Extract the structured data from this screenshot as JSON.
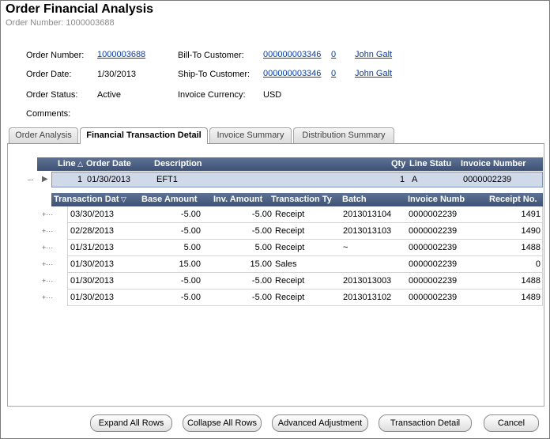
{
  "header": {
    "title": "Order Financial Analysis",
    "subtitle": "Order Number: 1000003688"
  },
  "summary": {
    "order_number_label": "Order Number:",
    "order_number": "1000003688",
    "order_date_label": "Order Date:",
    "order_date": "1/30/2013",
    "order_status_label": "Order Status:",
    "order_status": "Active",
    "comments_label": "Comments:",
    "bill_to_label": "Bill-To Customer:",
    "bill_to_id": "000000003346",
    "bill_to_zero": "0",
    "bill_to_name": "John Galt",
    "ship_to_label": "Ship-To Customer:",
    "ship_to_id": "000000003346",
    "ship_to_zero": "0",
    "ship_to_name": "John Galt",
    "currency_label": "Invoice Currency:",
    "currency": "USD"
  },
  "tabs": [
    {
      "label": "Order Analysis"
    },
    {
      "label": "Financial Transaction Detail"
    },
    {
      "label": "Invoice Summary"
    },
    {
      "label": "Distribution Summary"
    }
  ],
  "outer_grid": {
    "columns": [
      "Line",
      "Order Date",
      "Description",
      "Qty",
      "Line Statu",
      "Invoice Number"
    ],
    "row": {
      "line": "1",
      "order_date": "01/30/2013",
      "description": "EFT1",
      "qty": "1",
      "status": "A",
      "invoice": "0000002239"
    }
  },
  "inner_grid": {
    "columns": [
      "Transaction Dat",
      "Base Amount",
      "Inv. Amount",
      "Transaction Ty",
      "Batch",
      "Invoice Numb",
      "Receipt No."
    ],
    "rows": [
      {
        "date": "03/30/2013",
        "base": "-5.00",
        "inv": "-5.00",
        "type": "Receipt",
        "batch": "2013013104",
        "invoice": "0000002239",
        "receipt": "1491"
      },
      {
        "date": "02/28/2013",
        "base": "-5.00",
        "inv": "-5.00",
        "type": "Receipt",
        "batch": "2013013103",
        "invoice": "0000002239",
        "receipt": "1490"
      },
      {
        "date": "01/31/2013",
        "base": "5.00",
        "inv": "5.00",
        "type": "Receipt",
        "batch": "~",
        "invoice": "0000002239",
        "receipt": "1488"
      },
      {
        "date": "01/30/2013",
        "base": "15.00",
        "inv": "15.00",
        "type": "Sales",
        "batch": "",
        "invoice": "0000002239",
        "receipt": "0"
      },
      {
        "date": "01/30/2013",
        "base": "-5.00",
        "inv": "-5.00",
        "type": "Receipt",
        "batch": "2013013003",
        "invoice": "0000002239",
        "receipt": "1488"
      },
      {
        "date": "01/30/2013",
        "base": "-5.00",
        "inv": "-5.00",
        "type": "Receipt",
        "batch": "2013013102",
        "invoice": "0000002239",
        "receipt": "1489"
      }
    ]
  },
  "buttons": {
    "expand": "Expand All Rows",
    "collapse": "Collapse All Rows",
    "advanced": "Advanced Adjustment",
    "detail": "Transaction Detail",
    "cancel": "Cancel"
  }
}
